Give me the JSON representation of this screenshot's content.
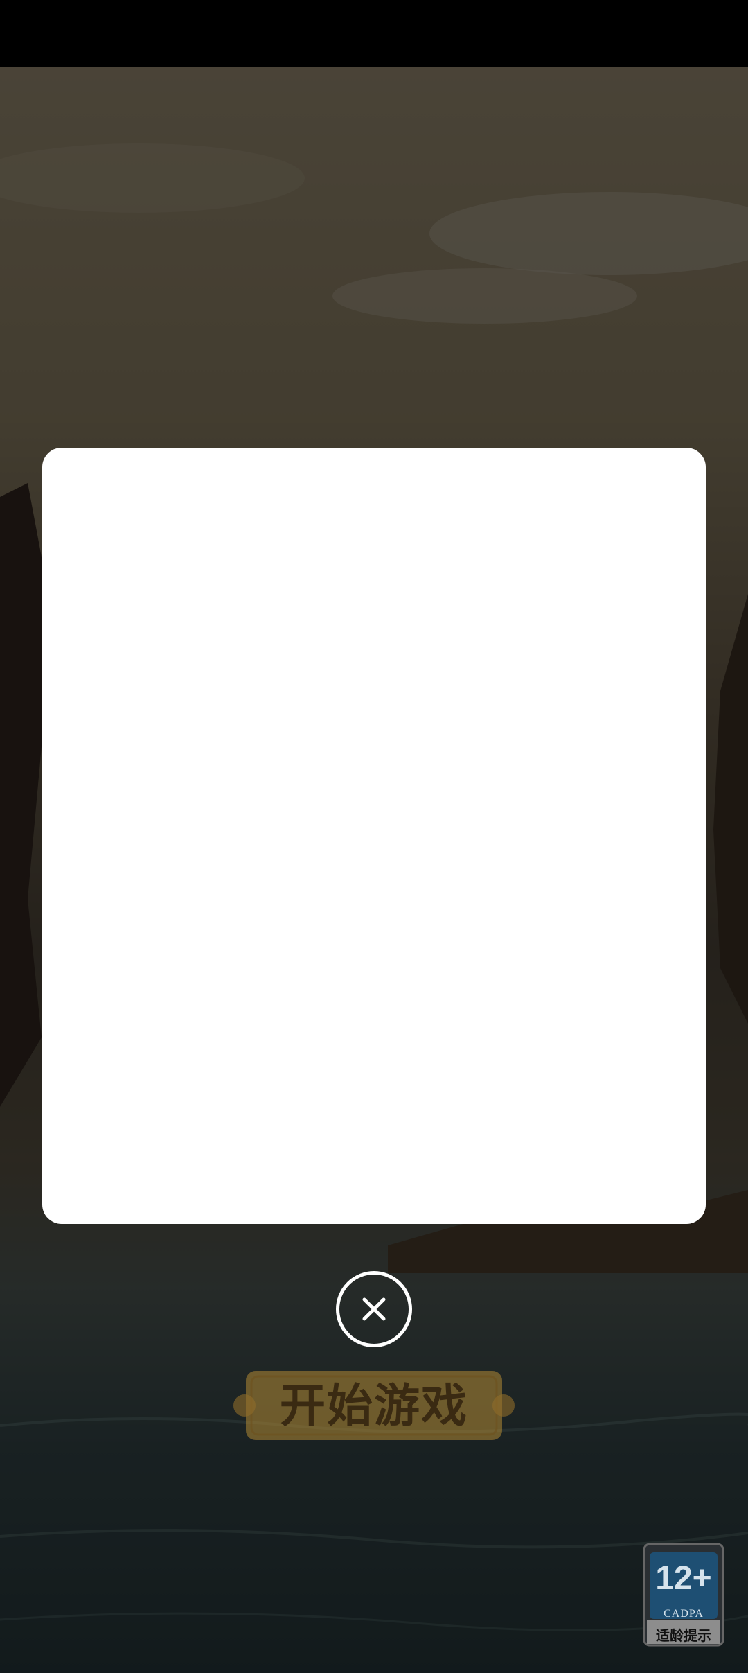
{
  "game": {
    "start_button_label": "开始游戏"
  },
  "modal": {
    "close_icon": "close-icon"
  },
  "age_rating": {
    "age": "12+",
    "org": "CADPA",
    "hint": "适龄提示"
  },
  "colors": {
    "overlay": "rgba(0,0,0,0.6)",
    "modal_bg": "#ffffff",
    "button_gold": "#b38b35"
  }
}
